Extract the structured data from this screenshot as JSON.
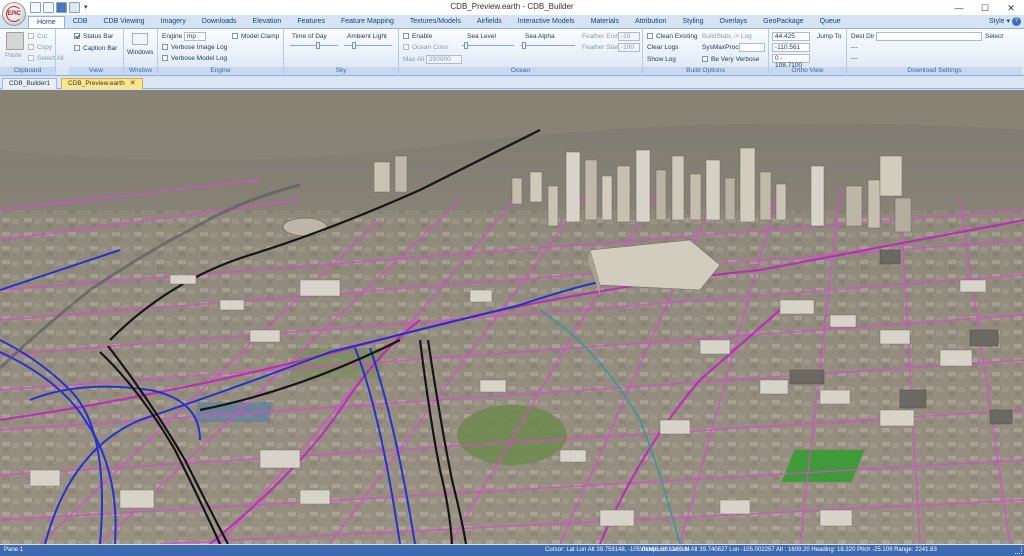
{
  "window": {
    "title": "CDB_Preview.earth - CDB_Builder",
    "logo_text": "EPIC",
    "minimize_glyph": "—",
    "maximize_glyph": "☐",
    "close_glyph": "✕"
  },
  "quick_access": {
    "dropdown_glyph": "▾"
  },
  "ribbon_tabs": [
    {
      "label": "Home"
    },
    {
      "label": "CDB"
    },
    {
      "label": "CDB Viewing"
    },
    {
      "label": "Imagery"
    },
    {
      "label": "Downloads"
    },
    {
      "label": "Elevation"
    },
    {
      "label": "Features"
    },
    {
      "label": "Feature Mapping"
    },
    {
      "label": "Textures/Models"
    },
    {
      "label": "Airfields"
    },
    {
      "label": "Interactive Models"
    },
    {
      "label": "Materials"
    },
    {
      "label": "Attribution"
    },
    {
      "label": "Styling"
    },
    {
      "label": "Overlays"
    },
    {
      "label": "GeoPackage"
    },
    {
      "label": "Queue"
    }
  ],
  "style_menu": {
    "label": "Style",
    "dropdown_glyph": "▾",
    "help_glyph": "?"
  },
  "groups": {
    "clipboard": {
      "label": "Clipboard",
      "paste": "Paste",
      "cut": "Cut",
      "copy": "Copy",
      "select_all": "Select All"
    },
    "view": {
      "label": "View",
      "status_bar": "Status Bar",
      "caption_bar": "Caption Bar"
    },
    "window": {
      "label": "Window",
      "windows": "Windows"
    },
    "engine": {
      "label": "Engine",
      "engine_label": "Engine",
      "engine_value": "mp",
      "model_clamp": "Model Clamp",
      "verbose_image_log": "Verbose Image Log",
      "verbose_model_log": "Verbose Model Log"
    },
    "sky": {
      "label": "Sky",
      "time_of_day": "Time of Day",
      "ambient_light": "Ambient Light"
    },
    "ocean": {
      "label": "Ocean",
      "enable": "Enable",
      "ocean_color": "Ocean Color",
      "max_alt_label": "Max Alt",
      "max_alt_value": "250000",
      "sea_level": "Sea Level",
      "sea_alpha": "Sea Alpha",
      "feather_end_label": "Feather End",
      "feather_end_value": "-10",
      "feather_start_label": "Feather Start",
      "feather_start_value": "-100"
    },
    "build_options": {
      "label": "Build Options",
      "clean_existing": "Clean Existing",
      "clear_logs": "Clear Logs",
      "show_log": "Show Log",
      "buildstats_log": "BuildStats -> Log",
      "sysmaxprocs": "SysMaxProcs",
      "be_very_verbose": "Be Very Verbose"
    },
    "ortho_view": {
      "label": "Ortho View",
      "lat_value": "44.425",
      "lon_value": "-110.561",
      "range_value": "0 - 108.7100",
      "jump_to": "Jump To"
    },
    "download_settings": {
      "label": "Download Settings",
      "dest_dir_label": "Dest Dir",
      "select": "Select",
      "placeholder_line1": "---",
      "placeholder_line2": "---"
    }
  },
  "doc_tabs": [
    {
      "label": "CDB_Builder1"
    },
    {
      "label": "CDB_Preview.earth",
      "close": "✕"
    }
  ],
  "status_bar": {
    "pane": "Pane 1",
    "cursor": "Cursor: Lat Lon Alt 39.759148, -105.01160, 1610.63 M",
    "viewpoint": "Viewpoint: Lat Lon Alt 39.740627 Lon -105.002257 Alt : 1609.20 Heading: 18.320 Pitch -25.109 Range: 2241.83"
  },
  "viewport": {
    "scene": "3d-city-view",
    "colors": {
      "ground": "#8b8478",
      "road_pink": "#d44fc8",
      "road_magenta": "#c020c0",
      "road_blue": "#1a2ad0",
      "rail_black": "#151515",
      "building_light": "#d8d3c8",
      "building_dark": "#6c6862",
      "park_green": "#6f8a4f",
      "field_green": "#3f9a3a",
      "water_blue": "#5f7f9f"
    }
  }
}
